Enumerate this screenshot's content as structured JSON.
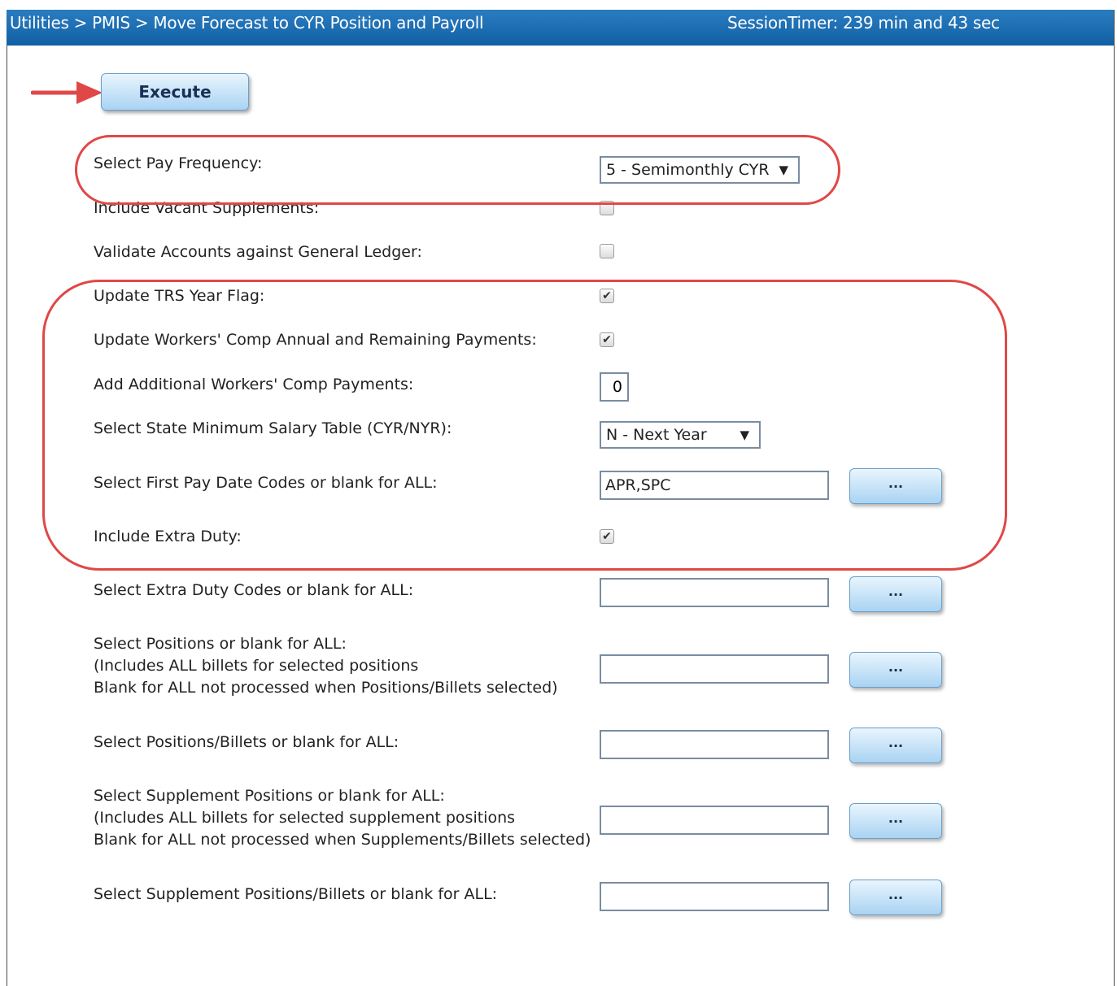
{
  "titlebar": {
    "breadcrumb": "Utilities > PMIS > Move Forecast to CYR Position and Payroll",
    "timer": "SessionTimer: 239 min and 43 sec"
  },
  "toolbar": {
    "execute_label": "Execute"
  },
  "form": {
    "pay_frequency": {
      "label": "Select Pay Frequency:",
      "value": "5 - Semimonthly CYR"
    },
    "include_vacant_supplements": {
      "label": "Include Vacant Supplements:",
      "checked": false
    },
    "validate_accounts": {
      "label": "Validate Accounts against General Ledger:",
      "checked": false
    },
    "update_trs_flag": {
      "label": "Update TRS Year Flag:",
      "checked": true
    },
    "update_workers_comp": {
      "label": "Update Workers' Comp Annual and Remaining Payments:",
      "checked": true
    },
    "additional_workers_comp": {
      "label": "Add Additional Workers' Comp Payments:",
      "value": "0"
    },
    "state_min_salary": {
      "label": "Select State Minimum Salary Table (CYR/NYR):",
      "value": "N - Next Year"
    },
    "first_pay_date": {
      "label": "Select First Pay Date Codes or blank for ALL:",
      "value": "APR,SPC"
    },
    "include_extra_duty": {
      "label": "Include Extra Duty:",
      "checked": true
    },
    "extra_duty_codes": {
      "label": "Select Extra Duty Codes or blank for ALL:",
      "value": ""
    },
    "positions": {
      "label1": "Select Positions or blank for ALL:",
      "label2": "(Includes ALL billets for selected positions",
      "label3": "Blank for ALL not processed when Positions/Billets selected)",
      "value": ""
    },
    "positions_billets": {
      "label": "Select Positions/Billets or blank for ALL:",
      "value": ""
    },
    "supplement_positions": {
      "label1": "Select Supplement Positions or blank for ALL:",
      "label2": "(Includes ALL billets for selected supplement positions",
      "label3": "Blank for ALL not processed when Supplements/Billets selected)",
      "value": ""
    },
    "supplement_billets": {
      "label": "Select Supplement Positions/Billets or blank for ALL:",
      "value": ""
    }
  },
  "ellipsis_label": "...",
  "caret_glyph": "▼",
  "check_glyph": "✔",
  "colors": {
    "titlebar": "#1565a9",
    "annotation": "#e04848"
  }
}
